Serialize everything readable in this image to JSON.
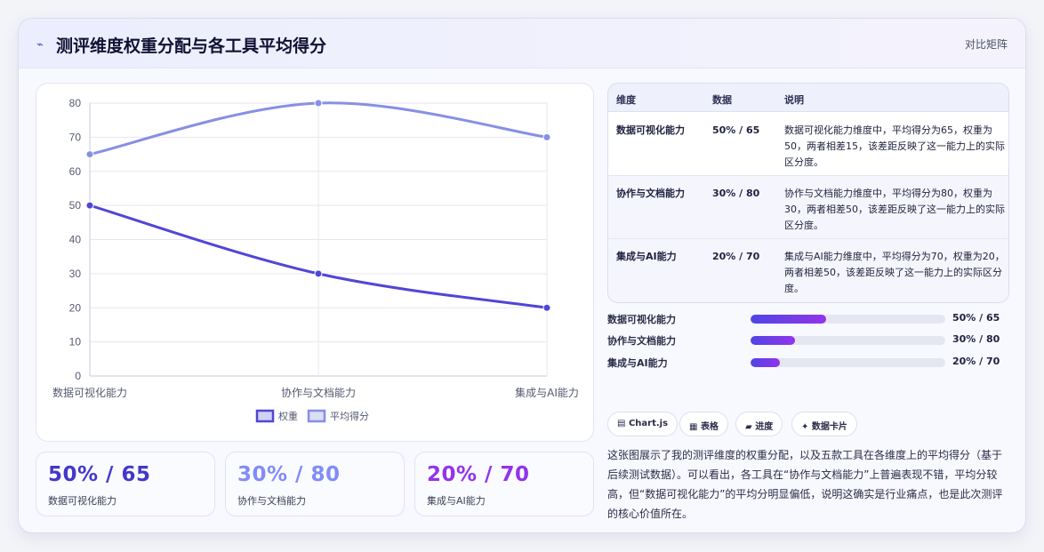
{
  "header": {
    "icon": "trend-icon",
    "icon_glyph": "⌁",
    "title": "测评维度权重分配与各工具平均得分",
    "tag": "对比矩阵"
  },
  "colors": {
    "weight": "#5046d6",
    "average": "#8690e4",
    "stat1": "#4338ca",
    "stat2": "#818cf8",
    "stat3": "#9333ea"
  },
  "chart_data": {
    "type": "line",
    "categories": [
      "数据可视化能力",
      "协作与文档能力",
      "集成与AI能力"
    ],
    "series": [
      {
        "name": "权重",
        "values": [
          50,
          30,
          20
        ]
      },
      {
        "name": "平均得分",
        "values": [
          65,
          80,
          70
        ]
      }
    ],
    "ylim": [
      0,
      80
    ],
    "yticks": [
      "0",
      "10",
      "20",
      "30",
      "40",
      "50",
      "60",
      "70",
      "80"
    ],
    "grid": true,
    "legend_position": "bottom"
  },
  "stats": [
    {
      "value": "50% / 65",
      "label": "数据可视化能力"
    },
    {
      "value": "30% / 80",
      "label": "协作与文档能力"
    },
    {
      "value": "20% / 70",
      "label": "集成与AI能力"
    }
  ],
  "table": {
    "headers": [
      "维度",
      "数据",
      "说明"
    ],
    "rows": [
      {
        "dim": "数据可视化能力",
        "data": "50% / 65",
        "desc": "数据可视化能力维度中，平均得分为65，权重为50，两者相差15，该差距反映了这一能力上的实际区分度。"
      },
      {
        "dim": "协作与文档能力",
        "data": "30% / 80",
        "desc": "协作与文档能力维度中，平均得分为80，权重为30，两者相差50，该差距反映了这一能力上的实际区分度。"
      },
      {
        "dim": "集成与AI能力",
        "data": "20% / 70",
        "desc": "集成与AI能力维度中，平均得分为70，权重为20，两者相差50，该差距反映了这一能力上的实际区分度。"
      }
    ]
  },
  "progress": [
    {
      "label": "数据可视化能力",
      "value": "50% / 65",
      "fraction": 0.39
    },
    {
      "label": "协作与文档能力",
      "value": "30% / 80",
      "fraction": 0.23
    },
    {
      "label": "集成与AI能力",
      "value": "20% / 70",
      "fraction": 0.15
    }
  ],
  "pills": [
    {
      "icon": "chart-icon",
      "glyph": "▤",
      "label": "Chart.js"
    },
    {
      "icon": "table-icon",
      "glyph": "▦",
      "label": "表格"
    },
    {
      "icon": "progress-icon",
      "glyph": "▰",
      "label": "进度"
    },
    {
      "icon": "sparkle-icon",
      "glyph": "✦",
      "label": "数据卡片"
    }
  ],
  "summary": "这张图展示了我的测评维度的权重分配，以及五款工具在各维度上的平均得分（基于后续测试数据）。可以看出，各工具在“协作与文档能力”上普遍表现不错，平均分较高，但“数据可视化能力”的平均分明显偏低，说明这确实是行业痛点，也是此次测评的核心价值所在。"
}
